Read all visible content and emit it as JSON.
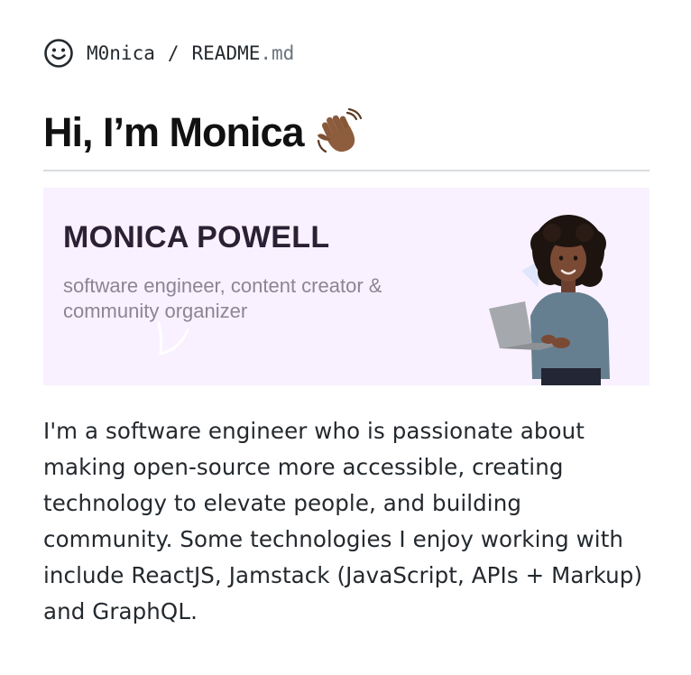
{
  "breadcrumb": {
    "repo": "M0nica",
    "separator": "/",
    "file_name": "README",
    "file_ext": ".md"
  },
  "heading": {
    "title": "Hi, I’m Monica"
  },
  "banner": {
    "name": "MONICA POWELL",
    "subtitle_line1": "software engineer, content creator &",
    "subtitle_line2": "community organizer"
  },
  "bio": {
    "text": "I'm a software engineer who is passionate about making open-source more accessible, creating technology to elevate people, and building community. Some technologies I enjoy working with include ReactJS, Jamstack (JavaScript, APIs + Markup) and GraphQL."
  },
  "colors": {
    "banner_bg": "#f9f1ff",
    "text": "#24292e",
    "muted": "#6a737d"
  }
}
